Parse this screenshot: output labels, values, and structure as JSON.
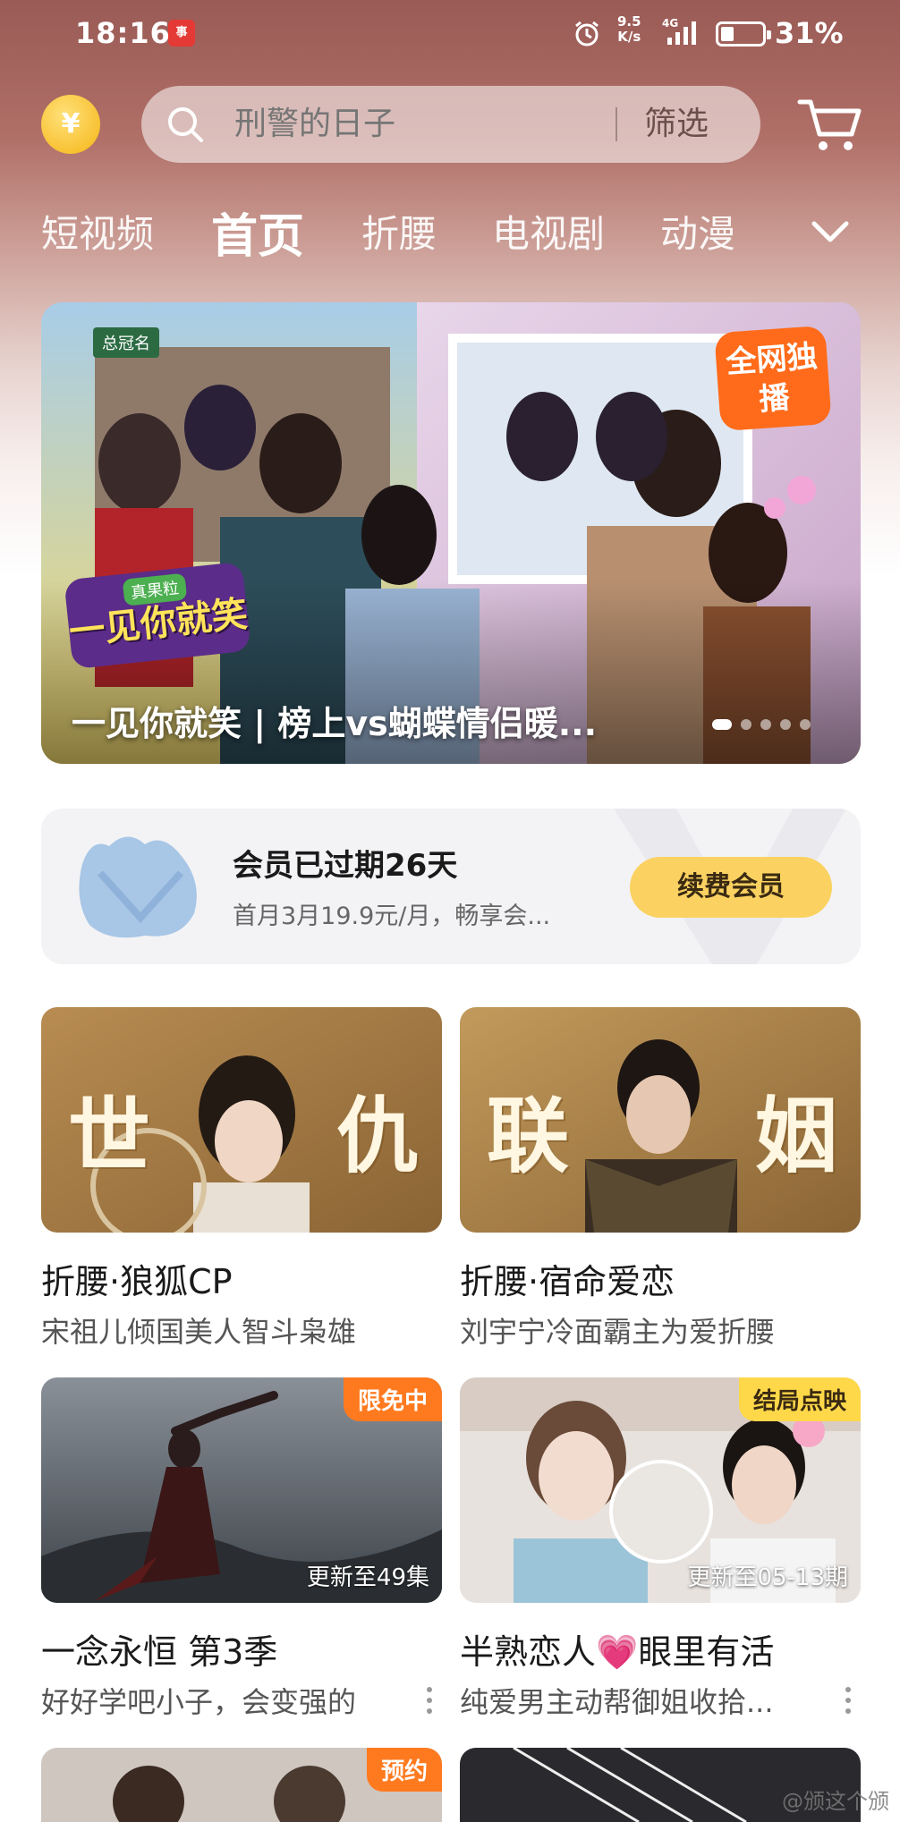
{
  "status_bar": {
    "time": "18:16",
    "app_icon_text": "事",
    "net_speed_value": "9.5",
    "net_speed_unit": "K/s",
    "network_type": "4G",
    "battery_level": 0.31,
    "battery_text": "31%"
  },
  "header": {
    "coin_symbol": "¥",
    "search_placeholder": "刑警的日子",
    "filter_label": "筛选"
  },
  "tabs": [
    {
      "label": "短视频",
      "active": false
    },
    {
      "label": "首页",
      "active": true
    },
    {
      "label": "折腰",
      "active": false
    },
    {
      "label": "电视剧",
      "active": false
    },
    {
      "label": "动漫",
      "active": false
    }
  ],
  "banner": {
    "sponsor_label": "总冠名",
    "logo_brand": "真果粒",
    "logo_title": "一见你就笑",
    "exclusive_badge": "全网独播",
    "title": "一见你就笑 | 榜上vs蝴蝶情侣暖...",
    "dot_count": 5,
    "active_dot": 0
  },
  "membership": {
    "title": "会员已过期26天",
    "subtitle": "首月3月19.9元/月，畅享会...",
    "renew_label": "续费会员"
  },
  "cards": [
    {
      "title": "折腰·狼狐CP",
      "subtitle": "宋祖儿倾国美人智斗枭雄",
      "art_left": "世",
      "art_right": "仇",
      "badge": "",
      "episode": ""
    },
    {
      "title": "折腰·宿命爱恋",
      "subtitle": "刘宇宁冷面霸主为爱折腰",
      "art_left": "联",
      "art_right": "姻",
      "badge": "",
      "episode": ""
    },
    {
      "title": "一念永恒 第3季",
      "subtitle": "好好学吧小子，会变强的",
      "badge": "限免中",
      "episode": "更新至49集"
    },
    {
      "title": "半熟恋人💗眼里有活",
      "subtitle": "纯爱男主动帮御姐收拾...",
      "badge": "结局点映",
      "episode": "更新至05-13期"
    },
    {
      "badge": "预约"
    }
  ],
  "watermark": "@颁这个颁",
  "colors": {
    "header_bg": "#a8645e",
    "accent_yellow": "#fbd261",
    "badge_orange": "#ff7a1f",
    "badge_yellow": "#ffd84a"
  }
}
